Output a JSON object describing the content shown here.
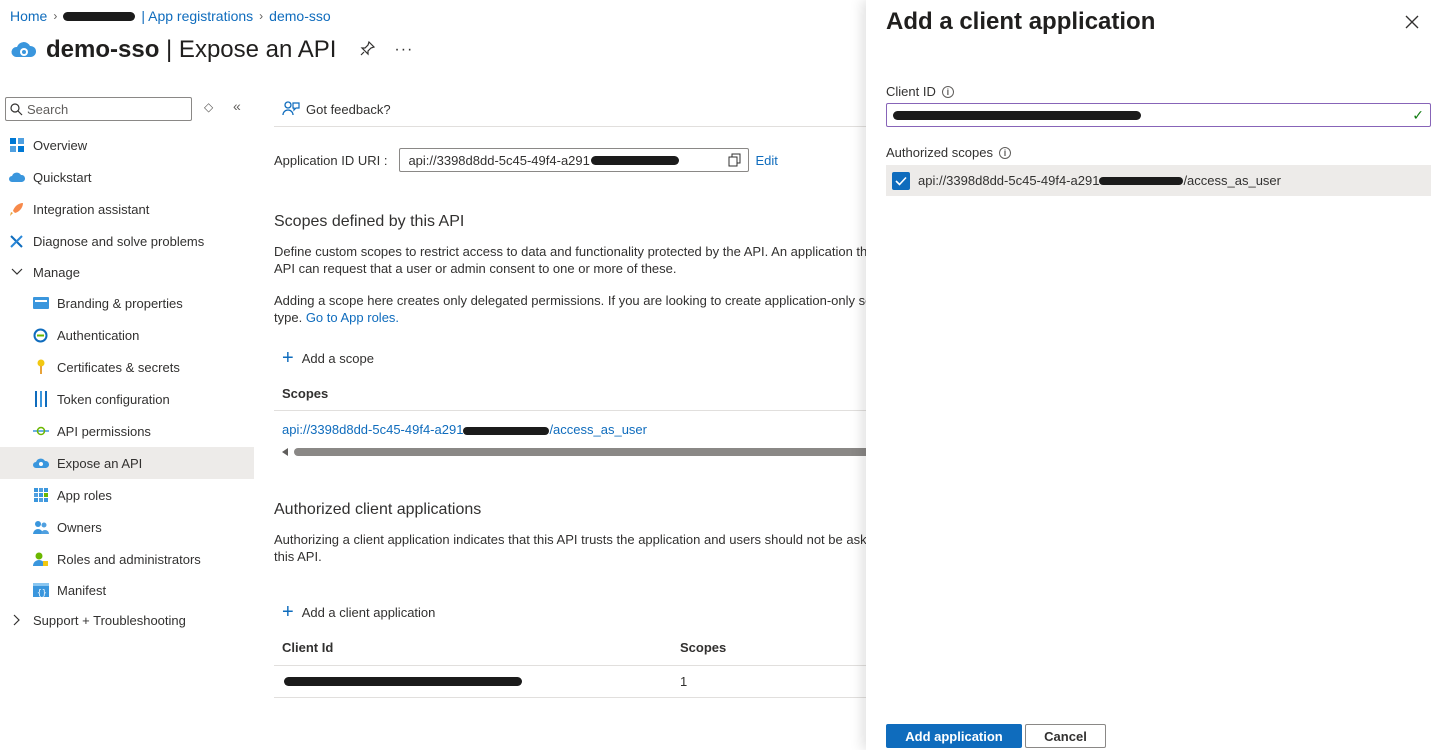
{
  "breadcrumb": {
    "home": "Home",
    "app_registrations": "| App registrations",
    "current": "demo-sso"
  },
  "header": {
    "app_name": "demo-sso",
    "page_name": "| Expose an API"
  },
  "sidebar": {
    "search_placeholder": "Search",
    "items": [
      {
        "label": "Overview",
        "icon": "grid-icon"
      },
      {
        "label": "Quickstart",
        "icon": "cloud-icon"
      },
      {
        "label": "Integration assistant",
        "icon": "rocket-icon"
      },
      {
        "label": "Diagnose and solve problems",
        "icon": "wrench-icon"
      },
      {
        "label": "Manage",
        "icon": "chevron-down-icon"
      },
      {
        "label": "Branding & properties",
        "icon": "card-icon"
      },
      {
        "label": "Authentication",
        "icon": "auth-icon"
      },
      {
        "label": "Certificates & secrets",
        "icon": "key-icon"
      },
      {
        "label": "Token configuration",
        "icon": "bars-icon"
      },
      {
        "label": "API permissions",
        "icon": "arrow-circle-icon"
      },
      {
        "label": "Expose an API",
        "icon": "cloud-gear-icon"
      },
      {
        "label": "App roles",
        "icon": "roles-grid-icon"
      },
      {
        "label": "Owners",
        "icon": "people-icon"
      },
      {
        "label": "Roles and administrators",
        "icon": "person-badge-icon"
      },
      {
        "label": "Manifest",
        "icon": "manifest-icon"
      },
      {
        "label": "Support + Troubleshooting",
        "icon": "chevron-right-icon"
      }
    ]
  },
  "main": {
    "feedback": "Got feedback?",
    "app_id_label": "Application ID URI :",
    "app_id_value": "api://3398d8dd-5c45-49f4-a291",
    "edit": "Edit",
    "scopes_section": {
      "title": "Scopes defined by this API",
      "para1_line1": "Define custom scopes to restrict access to data and functionality protected by the API. An application th",
      "para1_line2": "API can request that a user or admin consent to one or more of these.",
      "para2_line1": "Adding a scope here creates only delegated permissions. If you are looking to create application-only sc",
      "para2_prefix": "type.",
      "para2_link": "Go to App roles.",
      "add_scope": "Add a scope",
      "col_scopes": "Scopes",
      "scope_value_prefix": "api://3398d8dd-5c45-49f4-a291",
      "scope_value_suffix": "/access_as_user"
    },
    "clients_section": {
      "title": "Authorized client applications",
      "para_line1": "Authorizing a client application indicates that this API trusts the application and users should not be ask",
      "para_line2": "this API.",
      "add_client": "Add a client application",
      "col_client_id": "Client Id",
      "col_scopes": "Scopes",
      "row_scope_count": "1"
    }
  },
  "panel": {
    "title": "Add a client application",
    "client_id_label": "Client ID",
    "authorized_scopes_label": "Authorized scopes",
    "scope_prefix": "api://3398d8dd-5c45-49f4-a291",
    "scope_suffix": "/access_as_user",
    "add_button": "Add application",
    "cancel_button": "Cancel"
  },
  "colors": {
    "accent": "#0f6cbd",
    "valid": "#107c10",
    "focus_border": "#8764b8"
  }
}
